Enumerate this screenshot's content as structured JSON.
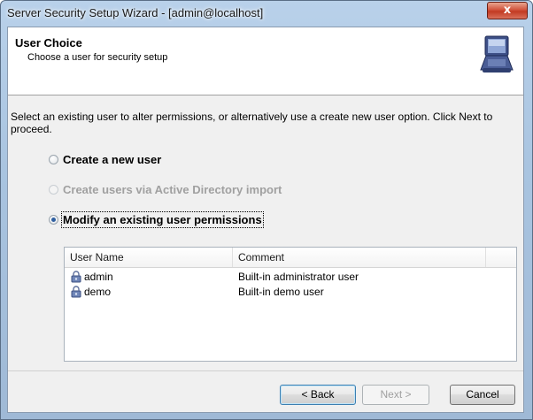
{
  "window": {
    "title": "Server Security Setup Wizard - [admin@localhost]",
    "close_glyph": "x"
  },
  "header": {
    "title": "User Choice",
    "subtitle": "Choose a user for security setup",
    "icon": "computer-monitor-icon"
  },
  "intro_text": "Select an existing user to alter permissions, or alternatively use a create new user option. Click Next to proceed.",
  "options": [
    {
      "label": "Create a new user",
      "checked": false,
      "enabled": true
    },
    {
      "label": "Create users via Active Directory import",
      "checked": false,
      "enabled": false
    },
    {
      "label": "Modify an existing user permissions",
      "checked": true,
      "enabled": true
    }
  ],
  "user_list": {
    "columns": [
      "User Name",
      "Comment"
    ],
    "rows": [
      {
        "name": "admin",
        "comment": "Built-in administrator user",
        "icon": "user-lock-icon"
      },
      {
        "name": "demo",
        "comment": "Built-in demo user",
        "icon": "user-lock-icon"
      }
    ]
  },
  "buttons": {
    "back": "< Back",
    "next": "Next >",
    "cancel": "Cancel"
  }
}
